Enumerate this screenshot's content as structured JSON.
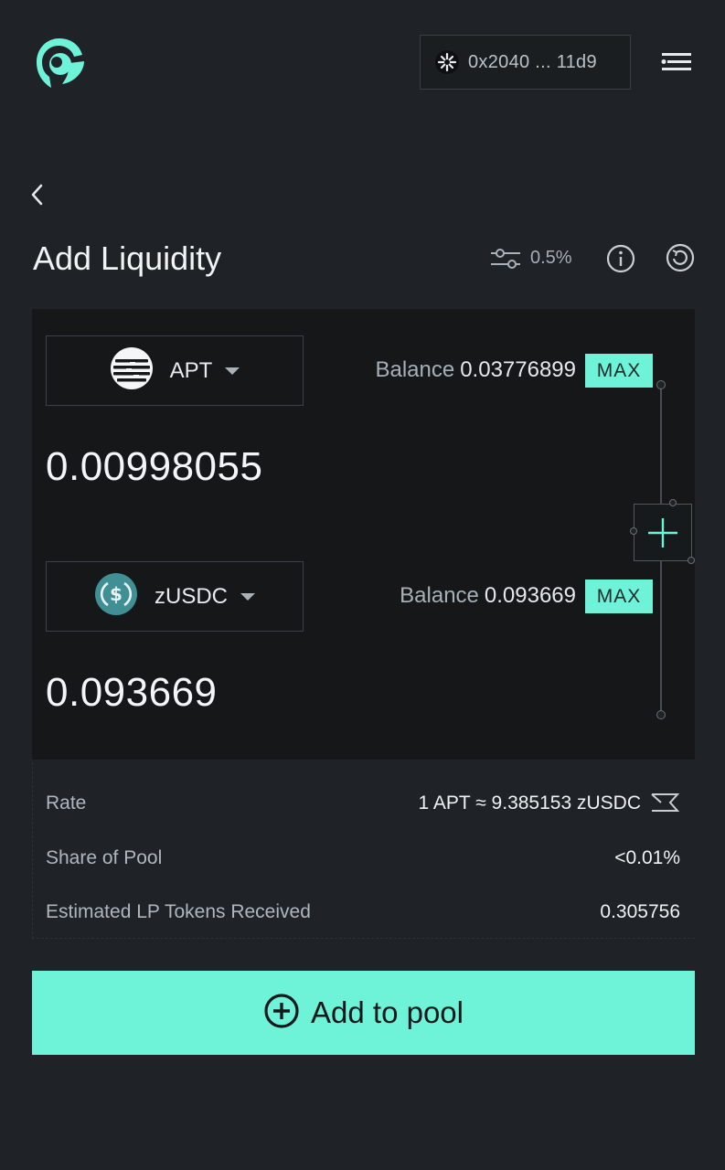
{
  "header": {
    "wallet_address": "0x2040 ... 11d9"
  },
  "page": {
    "title": "Add Liquidity",
    "slippage": "0.5%"
  },
  "token_a": {
    "symbol": "APT",
    "balance_label": "Balance",
    "balance_value": "0.03776899",
    "max_label": "MAX",
    "amount": "0.00998055"
  },
  "token_b": {
    "symbol": "zUSDC",
    "balance_label": "Balance",
    "balance_value": "0.093669",
    "max_label": "MAX",
    "amount": "0.093669"
  },
  "details": {
    "rate_label": "Rate",
    "rate_value": "1 APT ≈ 9.385153 zUSDC",
    "share_label": "Share of Pool",
    "share_value": "<0.01%",
    "lp_label": "Estimated LP Tokens Received",
    "lp_value": "0.305756"
  },
  "cta": {
    "label": "Add to pool"
  },
  "colors": {
    "accent": "#6ef3d9",
    "background": "#1f2226",
    "panel": "#151719"
  },
  "icons": {
    "logo": "app-logo",
    "wallet": "wallet-snowflake-icon",
    "menu": "menu-icon",
    "back": "back-chevron-icon",
    "slippage": "slippage-settings-icon",
    "info": "info-icon",
    "refresh": "refresh-icon",
    "apt": "apt-token-icon",
    "usdc": "usdc-token-icon",
    "caret": "caret-down-icon",
    "plus": "plus-icon",
    "swap_rate": "swap-rate-icon",
    "add_circle": "add-circle-icon"
  }
}
